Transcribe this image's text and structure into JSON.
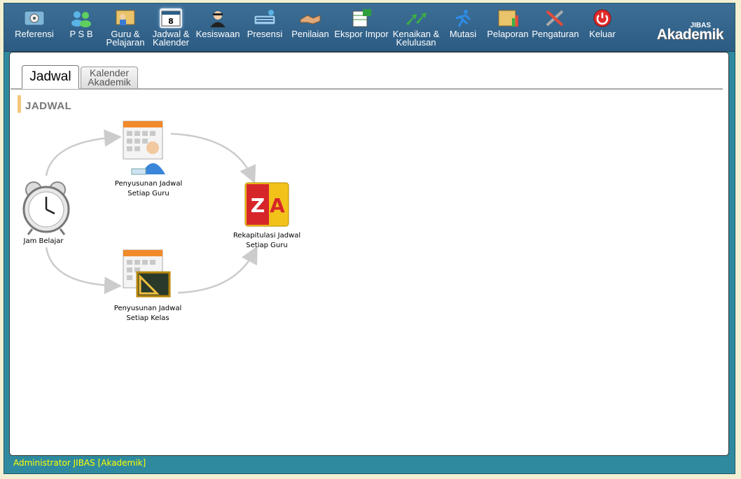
{
  "menu": [
    {
      "label": "Referensi",
      "icon": "gear-screen-icon"
    },
    {
      "label": "P S B",
      "icon": "people-icon"
    },
    {
      "label": "Guru &\nPelajaran",
      "icon": "teacher-board-icon"
    },
    {
      "label": "Jadwal &\nKalender",
      "icon": "calendar-icon"
    },
    {
      "label": "Kesiswaan",
      "icon": "student-icon"
    },
    {
      "label": "Presensi",
      "icon": "keyboard-icon"
    },
    {
      "label": "Penilaian",
      "icon": "handshake-icon"
    },
    {
      "label": "Ekspor Impor",
      "icon": "spreadsheet-icon"
    },
    {
      "label": "Kenaikan &\nKelulusan",
      "icon": "green-arrows-icon"
    },
    {
      "label": "Mutasi",
      "icon": "runner-icon"
    },
    {
      "label": "Pelaporan",
      "icon": "report-chart-icon"
    },
    {
      "label": "Pengaturan",
      "icon": "tools-icon"
    },
    {
      "label": "Keluar",
      "icon": "power-icon"
    }
  ],
  "brand": {
    "small": "JIBAS",
    "big": "Akademik"
  },
  "tabs": [
    {
      "label": "Jadwal",
      "active": true
    },
    {
      "label": "Kalender\nAkademik",
      "active": false
    }
  ],
  "section": {
    "title": "JADWAL"
  },
  "flow": {
    "jam_belajar": "Jam Belajar",
    "guru": "Penyusunan Jadwal\nSetiap Guru",
    "kelas": "Penyusunan Jadwal\nSetiap Kelas",
    "rekap": "Rekapitulasi Jadwal\nSetiap Guru"
  },
  "status": {
    "text": "Administrator JIBAS [Akademik]"
  },
  "colors": {
    "topbar": "#2c5b83",
    "frame": "#2f8aa0",
    "status_text": "#ffff00",
    "section_accent": "#f4c77b"
  }
}
